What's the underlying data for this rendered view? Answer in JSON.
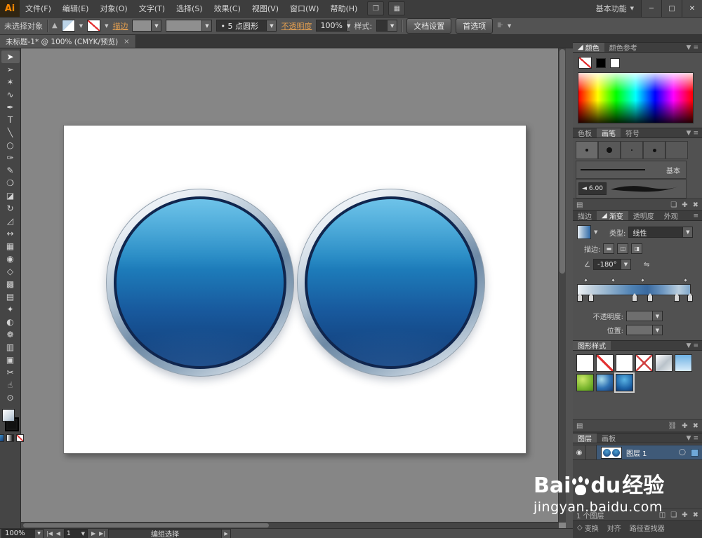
{
  "menubar": {
    "logo": "Ai",
    "items": [
      "文件(F)",
      "编辑(E)",
      "对象(O)",
      "文字(T)",
      "选择(S)",
      "效果(C)",
      "视图(V)",
      "窗口(W)",
      "帮助(H)"
    ],
    "arrange_icon": "❒",
    "grid_icon": "▦",
    "workspace": "基本功能",
    "workspace_arrow": "▼",
    "win_min": "─",
    "win_max": "□",
    "win_close": "✕"
  },
  "controlbar": {
    "no_selection": "未选择对象",
    "stroke_align_icon": "▲",
    "stroke_link": "描边",
    "weight_value": "",
    "profile_value": "",
    "brush_bullet": "•",
    "brush_value": "5 点圆形",
    "opacity_link": "不透明度",
    "opacity_value": "100%",
    "style_label": "样式:",
    "doc_setup_btn": "文档设置",
    "prefs_btn": "首选项",
    "align_icon": "⊪",
    "dd_arrow": "▼"
  },
  "tabbar": {
    "doc_title": "未标题-1*  @  100% (CMYK/预览)",
    "close": "×"
  },
  "toolbar": {
    "tools": [
      {
        "name": "selection-tool",
        "glyph": "➤"
      },
      {
        "name": "direct-selection-tool",
        "glyph": "➢"
      },
      {
        "name": "magic-wand-tool",
        "glyph": "✶"
      },
      {
        "name": "lasso-tool",
        "glyph": "∿"
      },
      {
        "name": "pen-tool",
        "glyph": "✒"
      },
      {
        "name": "type-tool",
        "glyph": "T"
      },
      {
        "name": "line-segment-tool",
        "glyph": "╲"
      },
      {
        "name": "ellipse-tool",
        "glyph": "○"
      },
      {
        "name": "paintbrush-tool",
        "glyph": "✑"
      },
      {
        "name": "pencil-tool",
        "glyph": "✎"
      },
      {
        "name": "blob-brush-tool",
        "glyph": "❍"
      },
      {
        "name": "eraser-tool",
        "glyph": "◪"
      },
      {
        "name": "rotate-tool",
        "glyph": "↻"
      },
      {
        "name": "scale-tool",
        "glyph": "◿"
      },
      {
        "name": "width-tool",
        "glyph": "↔"
      },
      {
        "name": "free-transform-tool",
        "glyph": "▦"
      },
      {
        "name": "shape-builder-tool",
        "glyph": "◉"
      },
      {
        "name": "perspective-grid-tool",
        "glyph": "◇"
      },
      {
        "name": "mesh-tool",
        "glyph": "▩"
      },
      {
        "name": "gradient-tool",
        "glyph": "▤"
      },
      {
        "name": "eyedropper-tool",
        "glyph": "✦"
      },
      {
        "name": "blend-tool",
        "glyph": "◐"
      },
      {
        "name": "symbol-sprayer-tool",
        "glyph": "❁"
      },
      {
        "name": "column-graph-tool",
        "glyph": "▥"
      },
      {
        "name": "artboard-tool",
        "glyph": "▣"
      },
      {
        "name": "slice-tool",
        "glyph": "✂"
      },
      {
        "name": "hand-tool",
        "glyph": "☝"
      },
      {
        "name": "zoom-tool",
        "glyph": "⊙"
      }
    ]
  },
  "panels": {
    "menu_icon": "≡",
    "collapse_icon": "▼",
    "color": {
      "tab_active": "颜色",
      "tab_inactive": "颜色参考",
      "corner_icon": "◢"
    },
    "brushes": {
      "tabs": [
        "色板",
        "画笔",
        "符号"
      ],
      "basic_label": "基本",
      "size_spinner": "◄",
      "size_value": "6.00",
      "lib_icon": "▤",
      "menu_icon": "❏",
      "new_icon": "✚",
      "delete_icon": "✖"
    },
    "gradient": {
      "tabs": [
        "描边",
        "渐变",
        "透明度",
        "外观"
      ],
      "active_tab": "渐变",
      "corner_icon": "◢",
      "type_label": "类型:",
      "type_value": "线性",
      "stroke_label": "描边:",
      "stroke_icons": [
        "▬",
        "◫",
        "◨"
      ],
      "angle_icon": "∠",
      "angle_value": "-180°",
      "reverse_icon": "⇋",
      "opacity_label": "不透明度:",
      "position_label": "位置:"
    },
    "graphic_styles": {
      "title": "图形样式",
      "lib_icon": "▤",
      "break_icon": "⛓",
      "new_icon": "✚",
      "delete_icon": "✖",
      "styles": [
        "default-white",
        "none",
        "white",
        "red-x",
        "silver-gradient",
        "sky-gradient",
        "green-texture",
        "blue-swirl",
        "blue-button"
      ]
    },
    "layers": {
      "tabs": [
        "图层",
        "画板"
      ],
      "eye_icon": "◉",
      "layer_name": "图层 1",
      "target_icon": "◯",
      "count": "1 个图层",
      "clip_icon": "◫",
      "sublayer_icon": "❏",
      "new_icon": "✚",
      "delete_icon": "✖"
    },
    "bottom_tabs": {
      "diamond_icon": "◇",
      "tabs": [
        "变换",
        "对齐",
        "路径查找器"
      ]
    }
  },
  "statusbar": {
    "zoom": "100%",
    "nav_first": "|◀",
    "nav_prev": "◀",
    "page": "1",
    "nav_next": "▶",
    "nav_last": "▶|",
    "tool": "编组选择",
    "go_icon": "▶",
    "dd_arrow": "▼"
  },
  "watermark": {
    "brand_a": "Bai",
    "brand_b": "du",
    "brand_c": "经验",
    "url": "jingyan.baidu.com"
  }
}
